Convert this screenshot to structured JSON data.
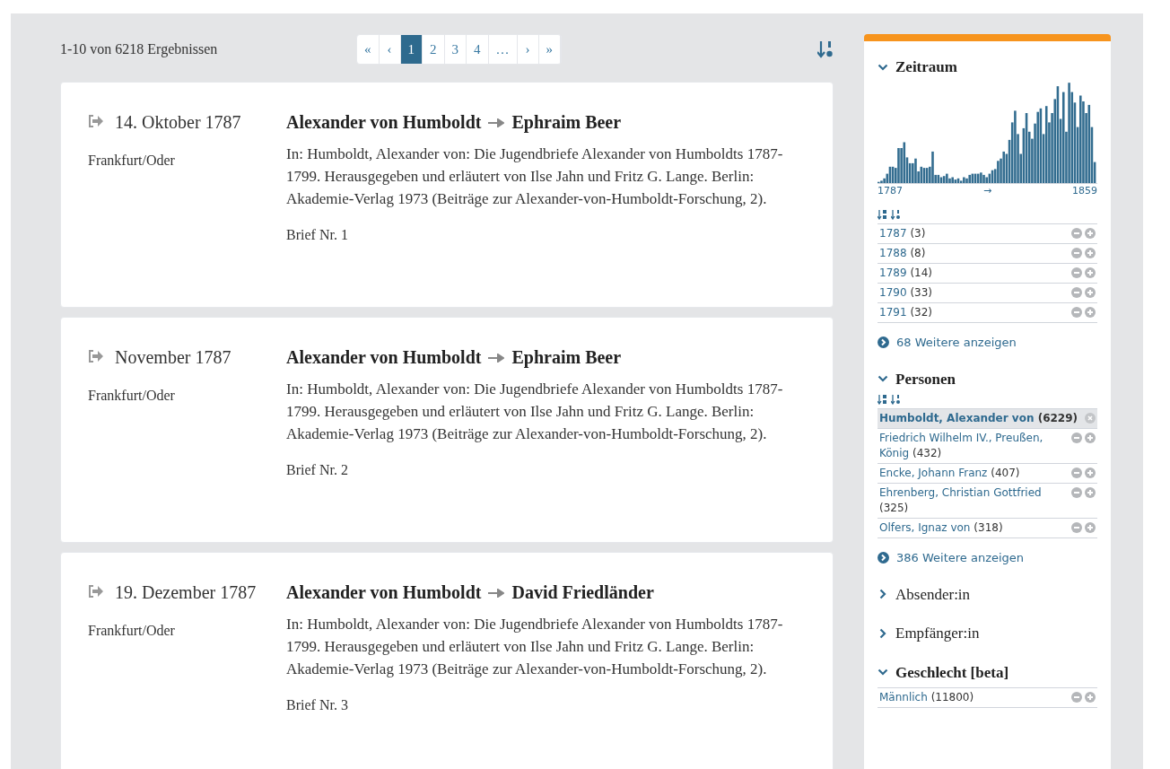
{
  "results_summary": "1-10 von 6218 Ergebnissen",
  "pagination": [
    {
      "label": "«",
      "selected": false
    },
    {
      "label": "‹",
      "selected": false
    },
    {
      "label": "1",
      "selected": true
    },
    {
      "label": "2",
      "selected": false
    },
    {
      "label": "3",
      "selected": false
    },
    {
      "label": "4",
      "selected": false
    },
    {
      "label": "…",
      "selected": false
    },
    {
      "label": "›",
      "selected": false
    },
    {
      "label": "»",
      "selected": false
    }
  ],
  "results": [
    {
      "date": "14. Oktober 1787",
      "place": "Frankfurt/Oder",
      "sender": "Alexander von Humboldt",
      "recipient": "Ephraim Beer",
      "source": "In: Humboldt, Alexander von: Die Jugendbriefe Alexander von Humboldts 1787-1799. Herausgegeben und erläutert von Ilse Jahn und Fritz G. Lange. Berlin: Akademie-Verlag 1973 (Beiträge zur Alexander-von-Humboldt-Forschung, 2).",
      "letter": "Brief Nr. 1"
    },
    {
      "date": "November 1787",
      "place": "Frankfurt/Oder",
      "sender": "Alexander von Humboldt",
      "recipient": "Ephraim Beer",
      "source": "In: Humboldt, Alexander von: Die Jugendbriefe Alexander von Humboldts 1787-1799. Herausgegeben und erläutert von Ilse Jahn und Fritz G. Lange. Berlin: Akademie-Verlag 1973 (Beiträge zur Alexander-von-Humboldt-Forschung, 2).",
      "letter": "Brief Nr. 2"
    },
    {
      "date": "19. Dezember 1787",
      "place": "Frankfurt/Oder",
      "sender": "Alexander von Humboldt",
      "recipient": "David Friedländer",
      "source": "In: Humboldt, Alexander von: Die Jugendbriefe Alexander von Humboldts 1787-1799. Herausgegeben und erläutert von Ilse Jahn und Fritz G. Lange. Berlin: Akademie-Verlag 1973 (Beiträge zur Alexander-von-Humboldt-Forschung, 2).",
      "letter": "Brief Nr. 3"
    }
  ],
  "facets": [
    {
      "title": "Zeitraum",
      "expanded": true,
      "kind": "histogram",
      "range_start": "1787",
      "range_arrow": "→",
      "range_end": "1859",
      "items": [
        {
          "label": "1787",
          "count": "(3)",
          "selected": false
        },
        {
          "label": "1788",
          "count": "(8)",
          "selected": false
        },
        {
          "label": "1789",
          "count": "(14)",
          "selected": false
        },
        {
          "label": "1790",
          "count": "(33)",
          "selected": false
        },
        {
          "label": "1791",
          "count": "(32)",
          "selected": false
        }
      ],
      "more": "68 Weitere anzeigen"
    },
    {
      "title": "Personen",
      "expanded": true,
      "kind": "list",
      "items": [
        {
          "label": "Humboldt, Alexander von",
          "count": "(6229)",
          "selected": true
        },
        {
          "label": "Friedrich Wilhelm IV., Preußen, König",
          "count": "(432)",
          "selected": false
        },
        {
          "label": "Encke, Johann Franz",
          "count": "(407)",
          "selected": false
        },
        {
          "label": "Ehrenberg, Christian Gottfried",
          "count": "(325)",
          "selected": false
        },
        {
          "label": "Olfers, Ignaz von",
          "count": "(318)",
          "selected": false
        }
      ],
      "more": "386 Weitere anzeigen"
    },
    {
      "title": "Absender:in",
      "expanded": false
    },
    {
      "title": "Empfänger:in",
      "expanded": false
    },
    {
      "title": "Geschlecht [beta]",
      "expanded": true,
      "kind": "plain",
      "items": [
        {
          "label": "Männlich",
          "count": "(11800)",
          "selected": false
        }
      ]
    }
  ]
}
